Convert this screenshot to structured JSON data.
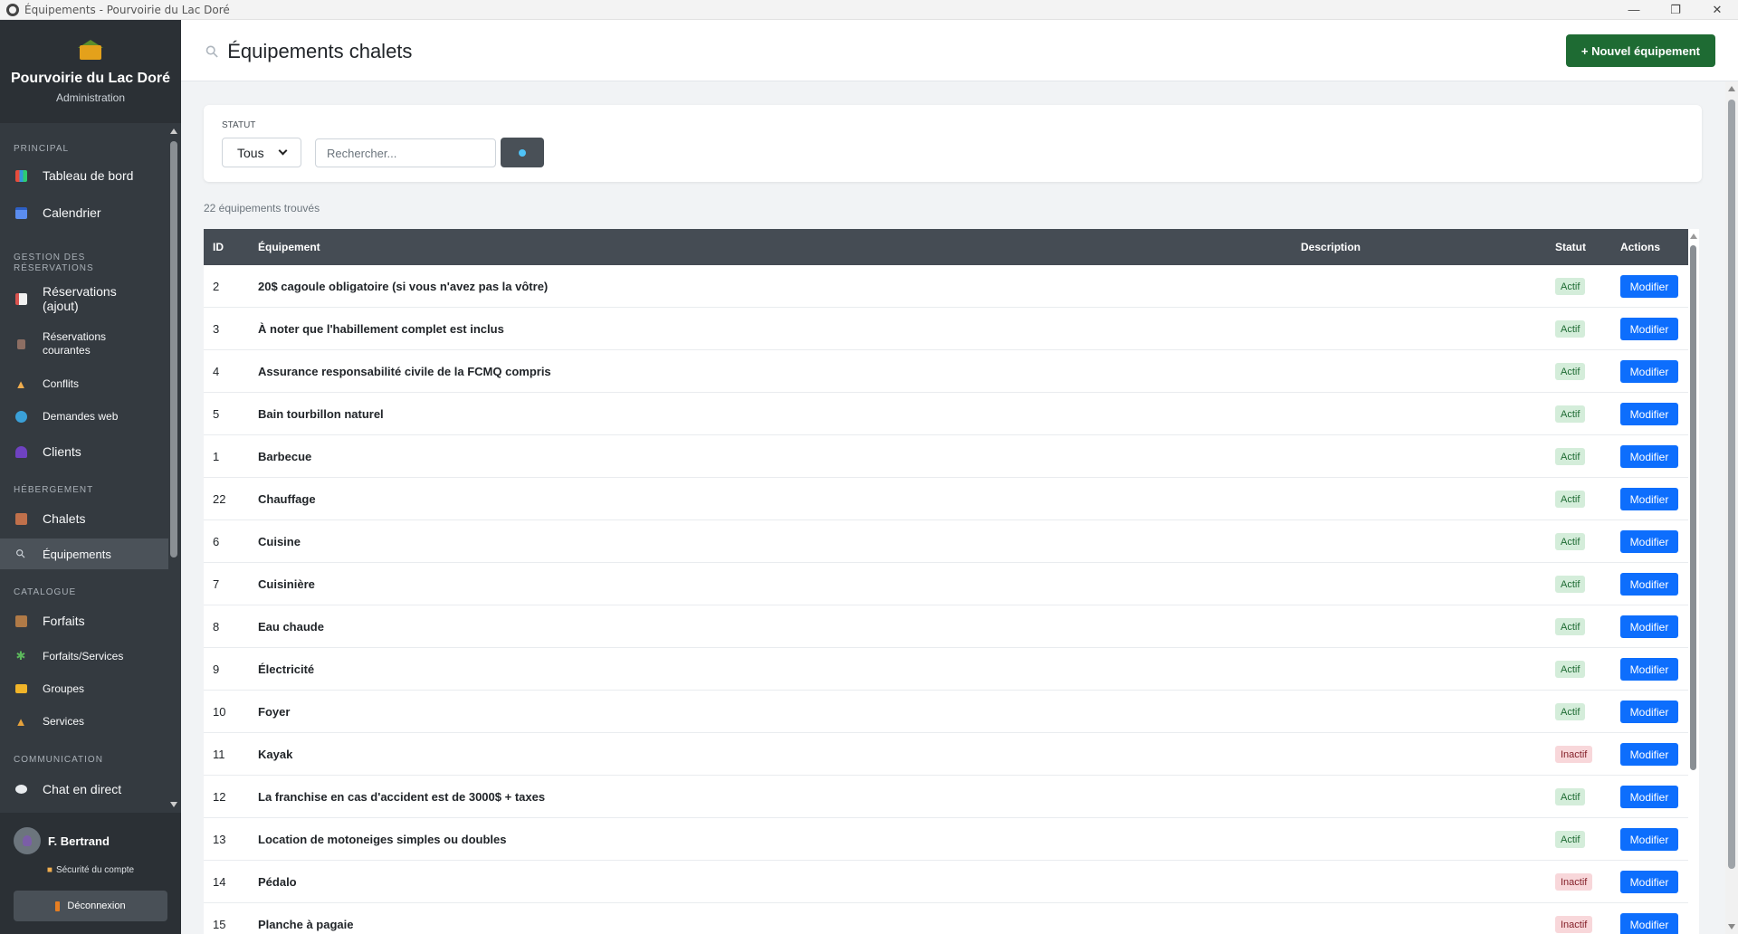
{
  "window": {
    "title": "Équipements - Pourvoirie du Lac Doré"
  },
  "brand": {
    "name": "Pourvoirie du Lac Doré",
    "subtitle": "Administration"
  },
  "nav": {
    "sections": {
      "principal": "PRINCIPAL",
      "reservations": "GESTION DES RÉSERVATIONS",
      "hebergement": "HÉBERGEMENT",
      "catalogue": "CATALOGUE",
      "communication": "COMMUNICATION"
    },
    "items": {
      "dashboard": "Tableau de bord",
      "calendar": "Calendrier",
      "reservations_add": "Réservations (ajout)",
      "reservations_current": "Réservations courantes",
      "conflicts": "Conflits",
      "web_requests": "Demandes web",
      "clients": "Clients",
      "chalets": "Chalets",
      "equipment": "Équipements",
      "packages": "Forfaits",
      "packages_services": "Forfaits/Services",
      "groups": "Groupes",
      "services": "Services",
      "chat": "Chat en direct"
    }
  },
  "user": {
    "name": "F. Bertrand",
    "security": "Sécurité du compte",
    "logout": "Déconnexion"
  },
  "header": {
    "title": "Équipements chalets",
    "new_button": "+ Nouvel équipement"
  },
  "filters": {
    "status_label": "STATUT",
    "status_value": "Tous",
    "search_placeholder": "Rechercher..."
  },
  "results_count": "22 équipements trouvés",
  "table": {
    "columns": {
      "id": "ID",
      "name": "Équipement",
      "description": "Description",
      "status": "Statut",
      "actions": "Actions"
    },
    "edit_label": "Modifier",
    "rows": [
      {
        "id": "2",
        "name": "20$ cagoule obligatoire (si vous n'avez pas la vôtre)",
        "status": "Actif"
      },
      {
        "id": "3",
        "name": "À noter que l'habillement complet est inclus",
        "status": "Actif"
      },
      {
        "id": "4",
        "name": "Assurance responsabilité civile de la FCMQ compris",
        "status": "Actif"
      },
      {
        "id": "5",
        "name": "Bain tourbillon naturel",
        "status": "Actif"
      },
      {
        "id": "1",
        "name": "Barbecue",
        "status": "Actif"
      },
      {
        "id": "22",
        "name": "Chauffage",
        "status": "Actif"
      },
      {
        "id": "6",
        "name": "Cuisine",
        "status": "Actif"
      },
      {
        "id": "7",
        "name": "Cuisinière",
        "status": "Actif"
      },
      {
        "id": "8",
        "name": "Eau chaude",
        "status": "Actif"
      },
      {
        "id": "9",
        "name": "Électricité",
        "status": "Actif"
      },
      {
        "id": "10",
        "name": "Foyer",
        "status": "Actif"
      },
      {
        "id": "11",
        "name": "Kayak",
        "status": "Inactif"
      },
      {
        "id": "12",
        "name": "La franchise en cas d'accident est de 3000$ + taxes",
        "status": "Actif"
      },
      {
        "id": "13",
        "name": "Location de motoneiges simples ou doubles",
        "status": "Actif"
      },
      {
        "id": "14",
        "name": "Pédalo",
        "status": "Inactif"
      },
      {
        "id": "15",
        "name": "Planche à pagaie",
        "status": "Inactif"
      }
    ]
  },
  "colors": {
    "sidebar": "#343a40",
    "primary": "#0d6efd",
    "success": "#1e6b33",
    "table_header": "#454c54"
  }
}
